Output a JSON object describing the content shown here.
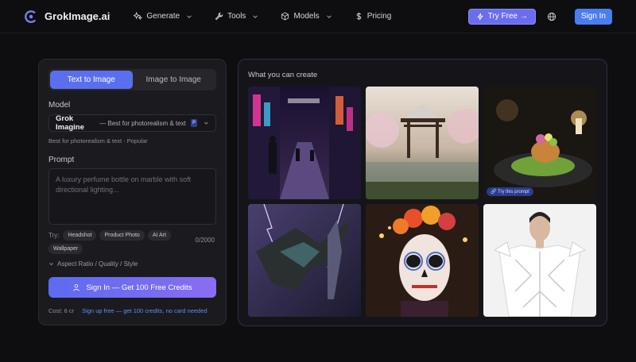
{
  "brand": {
    "name": "GrokImage.ai"
  },
  "nav": {
    "items": [
      {
        "label": "Generate",
        "icon": "sparkles-icon",
        "dropdown": true
      },
      {
        "label": "Tools",
        "icon": "wrench-icon",
        "dropdown": true
      },
      {
        "label": "Models",
        "icon": "cube-icon",
        "dropdown": true
      },
      {
        "label": "Pricing",
        "icon": "dollar-icon",
        "dropdown": false
      }
    ],
    "try_free": "Try Free →",
    "sign_in": "Sign In"
  },
  "generator": {
    "tabs": [
      "Text to Image",
      "Image to Image"
    ],
    "model_label": "Model",
    "model_name": "Grok Imagine",
    "model_desc": "— Best for photorealism & text",
    "model_badge": "P",
    "model_hint": "Best for photorealism & text · Popular",
    "prompt_label": "Prompt",
    "prompt_placeholder": "A luxury perfume bottle on marble with soft directional lighting...",
    "try_label": "Try:",
    "chips": [
      "Headshot",
      "Product Photo",
      "AI Art",
      "Wallpaper"
    ],
    "counter": "0/2000",
    "aspect": "Aspect Ratio / Quality / Style",
    "cta": "Sign In — Get 100 Free Credits",
    "cost": "Cost: 6 cr",
    "signup": "Sign up free — get 100 credits, no card needed"
  },
  "gallery": {
    "title": "What you can create",
    "tiles": [
      "neon-street",
      "torii-gate",
      "gourmet-dish",
      "storm-dragon",
      "sugar-skull-portrait",
      "white-fashion"
    ],
    "try_prompt": "🔗 Try this prompt"
  },
  "colors": {
    "accent": "#5a6ff0",
    "signin": "#4a7df0",
    "background": "#0e0e10",
    "panel": "#1b1b1f"
  }
}
